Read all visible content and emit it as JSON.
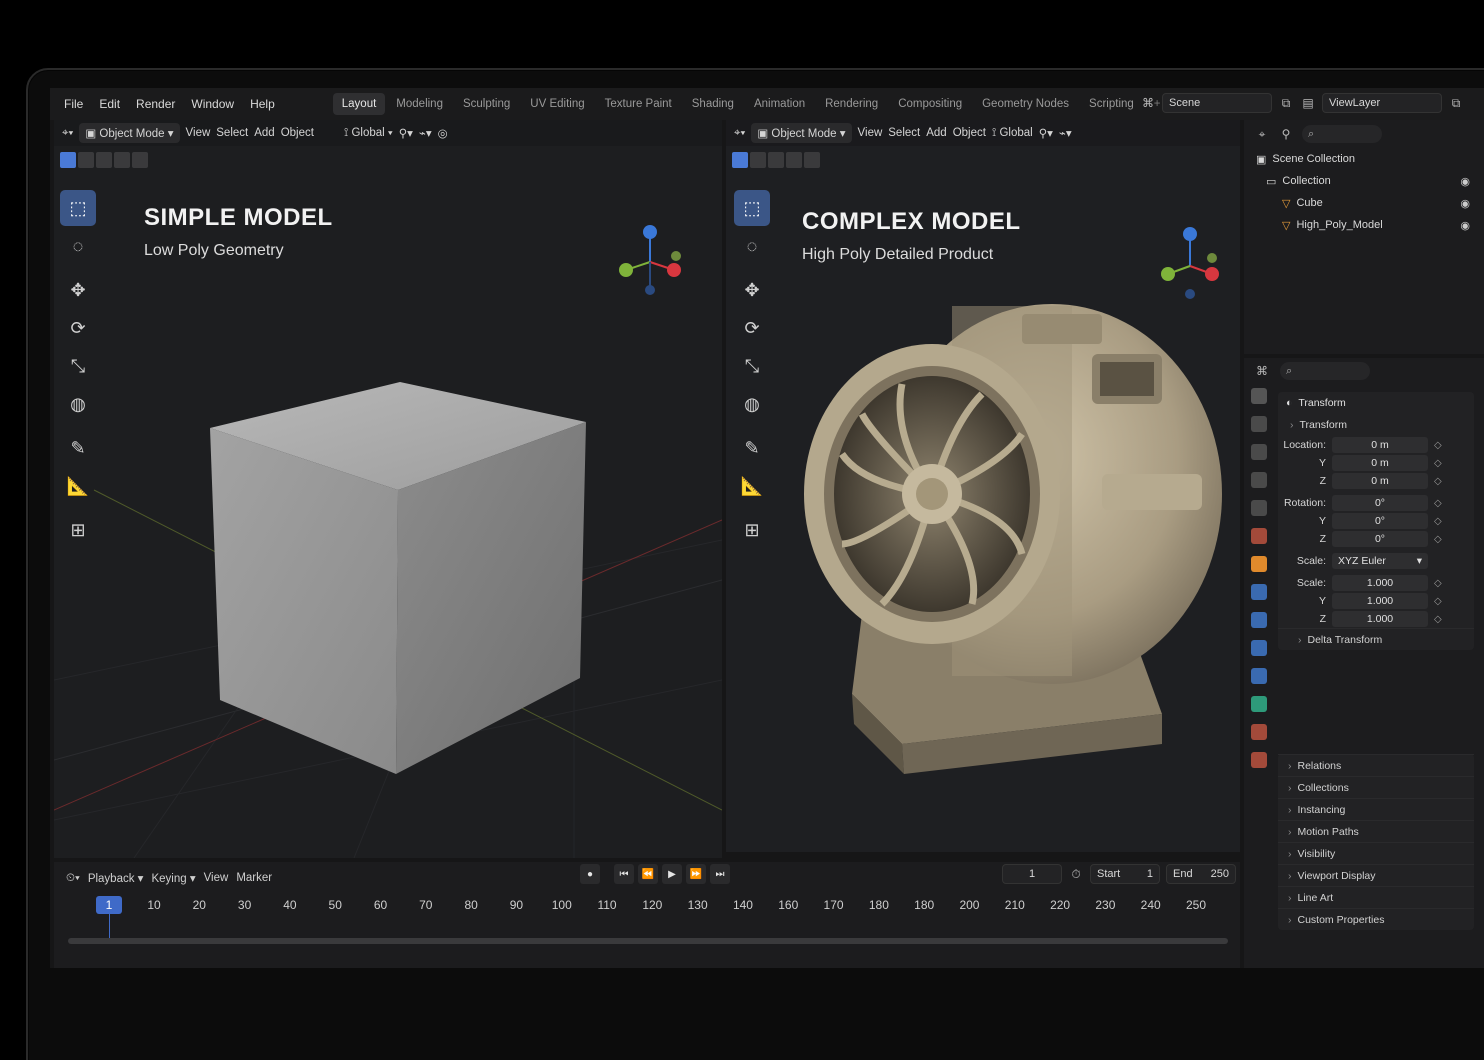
{
  "menu": [
    "File",
    "Edit",
    "Render",
    "Window",
    "Help"
  ],
  "workspaces": [
    {
      "label": "Layout",
      "active": true
    },
    {
      "label": "Modeling"
    },
    {
      "label": "Sculpting"
    },
    {
      "label": "UV Editing"
    },
    {
      "label": "Texture Paint"
    },
    {
      "label": "Shading"
    },
    {
      "label": "Animation"
    },
    {
      "label": "Rendering"
    },
    {
      "label": "Compositing"
    },
    {
      "label": "Geometry Nodes"
    },
    {
      "label": "Scripting"
    }
  ],
  "scene": {
    "name": "Scene",
    "view_layer": "ViewLayer"
  },
  "left_viewport": {
    "mode": "Object Mode",
    "menus": [
      "View",
      "Select",
      "Add",
      "Object"
    ],
    "transform_orientation": "Global",
    "title": "SIMPLE MODEL",
    "subtitle": "Low Poly Geometry"
  },
  "right_viewport": {
    "mode": "Object Mode",
    "menus": [
      "View",
      "Select",
      "Add",
      "Object"
    ],
    "transform_orientation": "Global",
    "title": "COMPLEX MODEL",
    "subtitle": "High Poly Detailed Product"
  },
  "outliner": {
    "root": "Scene Collection",
    "collection": "Collection",
    "objects": [
      "Cube",
      "High_Poly_Model"
    ]
  },
  "properties": {
    "section": "Transform",
    "subsection": "Transform",
    "location_label": "Location:",
    "location": [
      "0 m",
      "0 m",
      "0 m"
    ],
    "rotation_label": "Rotation:",
    "rotation": [
      "0°",
      "0°",
      "0°"
    ],
    "rotation_mode_label": "Scale:",
    "rotation_mode": "XYZ Euler",
    "scale_label": "Scale:",
    "scale": [
      "1.000",
      "1.000",
      "1.000"
    ],
    "axis_y": "Y",
    "axis_z": "Z",
    "delta": "Delta Transform",
    "panels": [
      "Relations",
      "Collections",
      "Instancing",
      "Motion Paths",
      "Visibility",
      "Viewport Display",
      "Line Art",
      "Custom Properties"
    ]
  },
  "timeline": {
    "menus": [
      "Playback",
      "Keying",
      "View",
      "Marker"
    ],
    "current_frame": "1",
    "current_frame_field": "1",
    "start_label": "Start",
    "start": "1",
    "end_label": "End",
    "end": "250",
    "ticks": [
      "10",
      "20",
      "30",
      "40",
      "50",
      "60",
      "70",
      "80",
      "90",
      "100",
      "110",
      "120",
      "130",
      "140",
      "160",
      "170",
      "180",
      "180",
      "200",
      "210",
      "220",
      "230",
      "240",
      "250"
    ]
  },
  "colors": {
    "accent": "#3f6ac8",
    "gizmo_x": "#d8373f",
    "gizmo_y": "#7fb33a",
    "gizmo_z": "#3a78d8",
    "engine": "#a99c82"
  }
}
